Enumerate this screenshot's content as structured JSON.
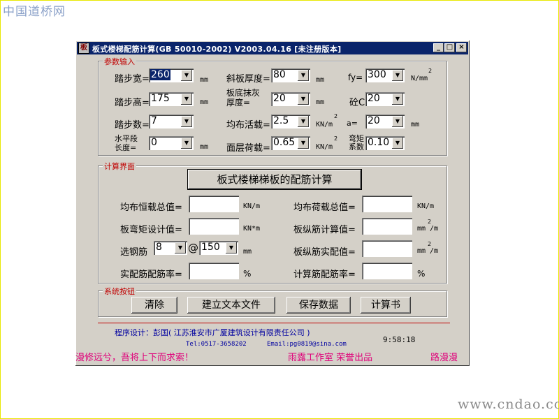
{
  "watermarks": {
    "top": "中国道桥网",
    "bottom": "www.cndao.com"
  },
  "window": {
    "icon_glyph": "板",
    "title": "板式楼梯配筋计算(GB 50010-2002) V2003.04.16  [未注册版本]",
    "min_glyph": "_",
    "max_glyph": "□",
    "close_glyph": "×"
  },
  "params": {
    "group_label": "参数输入",
    "tread_width": {
      "label": "踏步宽=",
      "value": "260",
      "unit": "mm"
    },
    "tread_height": {
      "label": "踏步高=",
      "value": "175",
      "unit": "mm"
    },
    "step_count": {
      "label": "踏步数=",
      "value": "7"
    },
    "horizontal_length": {
      "label_line1": "水平段",
      "label_line2": "长度=",
      "value": "0",
      "unit": "mm"
    },
    "slab_thickness": {
      "label": "斜板厚度=",
      "value": "80",
      "unit": "mm"
    },
    "plaster_thickness": {
      "label_line1": "板底抹灰",
      "label_line2": "厚度=",
      "value": "20",
      "unit": "mm"
    },
    "live_load": {
      "label": "均布活载=",
      "value": "2.5",
      "unit": "KN/m",
      "unit_sup": "2"
    },
    "surface_load": {
      "label": "面层荷载=",
      "value": "0.65",
      "unit": "KN/m",
      "unit_sup": "2"
    },
    "fy": {
      "label": "fy=",
      "value": "300",
      "unit": "N/mm",
      "unit_sup": "2"
    },
    "concrete": {
      "label": "砼C",
      "value": "20"
    },
    "a": {
      "label": "a=",
      "value": "20",
      "unit": "mm"
    },
    "moment_coef": {
      "label_line1": "弯矩",
      "label_line2": "系数",
      "value": "0.10"
    }
  },
  "calc": {
    "group_label": "计算界面",
    "calc_button": "板式楼梯梯板的配筋计算",
    "dead_load_total": {
      "label": "均布恒载总值=",
      "unit": "KN/m"
    },
    "load_total": {
      "label": "均布荷载总值=",
      "unit": "KN/m"
    },
    "design_moment": {
      "label": "板弯矩设计值=",
      "unit": "KN*m"
    },
    "rebar_calc": {
      "label": "板纵筋计算值=",
      "unit": "mm",
      "unit_sup": "2",
      "unit_tail": "/m"
    },
    "rebar_select": {
      "label": "选钢筋",
      "diameter": "8",
      "at": "@",
      "spacing": "150",
      "unit": "mm"
    },
    "rebar_actual": {
      "label": "板纵筋实配值=",
      "unit": "mm",
      "unit_sup": "2",
      "unit_tail": "/m"
    },
    "actual_ratio": {
      "label": "实配筋配筋率=",
      "unit": "%"
    },
    "calc_ratio": {
      "label": "计算筋配筋率=",
      "unit": "%"
    }
  },
  "system": {
    "group_label": "系统按钮",
    "clear": "清除",
    "create_text": "建立文本文件",
    "save": "保存数据",
    "report": "计算书"
  },
  "footer": {
    "credit": "程序设计：彭国( 江苏淮安市广厦建筑设计有限责任公司 )",
    "tel": "Tel:0517-3658202",
    "email": "Email:pg0819@sina.com",
    "clock": "9:58:18",
    "marquee_left": "漫修远兮，吾将上下而求索！",
    "marquee_mid": "雨露工作室  荣誉出品",
    "marquee_right": "路漫漫"
  }
}
